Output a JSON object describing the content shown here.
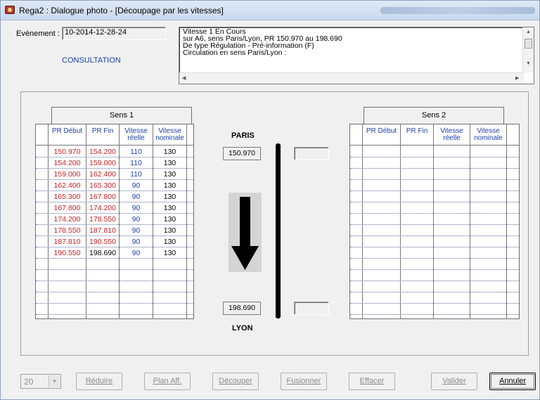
{
  "window": {
    "title": "Rega2 : Dialogue photo - [Découpage par les vitesses]"
  },
  "event": {
    "label": "Evénement :",
    "value": "10-2014-12-28-24",
    "mode": "CONSULTATION",
    "description": [
      "Vitesse 1 En Cours",
      "sur A6, sens Paris/Lyon, PR 150.970 au 198.690",
      "De type Régulation - Pré-information (F)",
      "Circulation en sens Paris/Lyon :"
    ]
  },
  "sens1": {
    "title": "Sens 1",
    "columns": [
      "PR Début",
      "PR Fin",
      "Vitesse réelle",
      "Vitesse nominale"
    ],
    "rows": [
      [
        "150.970",
        "154.200",
        "110",
        "130"
      ],
      [
        "154.200",
        "159.000",
        "110",
        "130"
      ],
      [
        "159.000",
        "162.400",
        "110",
        "130"
      ],
      [
        "162.400",
        "165.300",
        "90",
        "130"
      ],
      [
        "165.300",
        "167.800",
        "90",
        "130"
      ],
      [
        "167.800",
        "174.200",
        "90",
        "130"
      ],
      [
        "174.200",
        "178.550",
        "90",
        "130"
      ],
      [
        "178.550",
        "187.810",
        "90",
        "130"
      ],
      [
        "187.810",
        "190.550",
        "90",
        "130"
      ],
      [
        "190.550",
        "198.690",
        "90",
        "130"
      ]
    ]
  },
  "sens2": {
    "title": "Sens 2",
    "columns": [
      "PR Début",
      "PR Fin",
      "Vitesse réelle",
      "Vitesse nominale"
    ],
    "rows": []
  },
  "direction": {
    "top_city": "PARIS",
    "bottom_city": "LYON",
    "pr_start": "150.970",
    "pr_end": "198.690"
  },
  "toolbar": {
    "combo_value": "20",
    "buttons": [
      {
        "label": "Réduire",
        "enabled": false
      },
      {
        "label": "Plan Aff.",
        "enabled": false
      },
      {
        "label": "Découper",
        "enabled": false
      },
      {
        "label": "Fusionner",
        "enabled": false
      },
      {
        "label": "Effacer",
        "enabled": false
      },
      {
        "label": "Valider",
        "enabled": false
      },
      {
        "label": "Annuler",
        "enabled": true
      }
    ]
  },
  "colors": {
    "pr_modified": "#cc2020",
    "pr_normal": "#000000",
    "speed": "#1c3fa8",
    "title_bar": "#dfe9f5"
  }
}
